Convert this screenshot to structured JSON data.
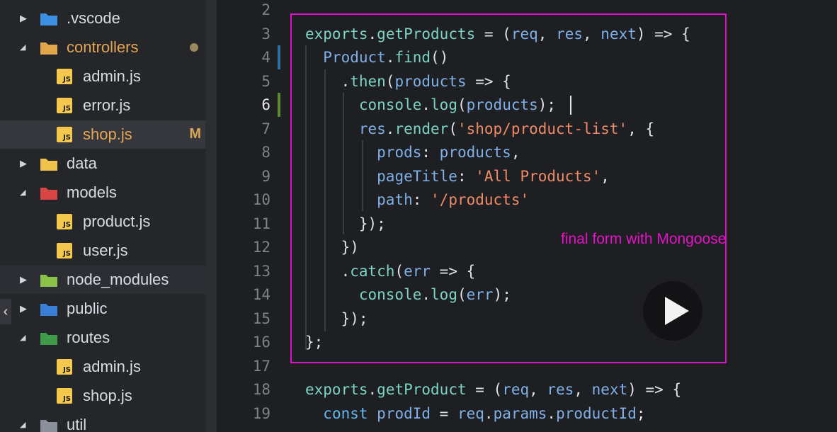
{
  "explorer": {
    "items": [
      {
        "name": ".vscode",
        "kind": "folder",
        "expanded": false,
        "icon": "vscode-folder-icon"
      },
      {
        "name": "controllers",
        "kind": "folder",
        "expanded": true,
        "modified_dot": true,
        "icon": "controllers-folder-icon"
      },
      {
        "name": "admin.js",
        "kind": "file",
        "icon": "js-file-icon"
      },
      {
        "name": "error.js",
        "kind": "file",
        "icon": "js-file-icon"
      },
      {
        "name": "shop.js",
        "kind": "file",
        "selected": true,
        "status": "M",
        "icon": "js-file-icon"
      },
      {
        "name": "data",
        "kind": "folder",
        "expanded": false,
        "icon": "data-folder-icon"
      },
      {
        "name": "models",
        "kind": "folder",
        "expanded": true,
        "icon": "models-folder-icon"
      },
      {
        "name": "product.js",
        "kind": "file",
        "icon": "js-file-icon"
      },
      {
        "name": "user.js",
        "kind": "file",
        "icon": "js-file-icon"
      },
      {
        "name": "node_modules",
        "kind": "folder",
        "expanded": false,
        "icon": "node-modules-folder-icon"
      },
      {
        "name": "public",
        "kind": "folder",
        "expanded": false,
        "icon": "public-folder-icon"
      },
      {
        "name": "routes",
        "kind": "folder",
        "expanded": true,
        "icon": "routes-folder-icon"
      },
      {
        "name": "admin.js",
        "kind": "file",
        "icon": "js-file-icon"
      },
      {
        "name": "shop.js",
        "kind": "file",
        "icon": "js-file-icon"
      },
      {
        "name": "util",
        "kind": "folder",
        "expanded": true,
        "icon": "util-folder-icon"
      }
    ],
    "js_badge": "JS",
    "collapse_glyph": "‹"
  },
  "editor": {
    "line_numbers": [
      "2",
      "3",
      "4",
      "5",
      "6",
      "7",
      "8",
      "9",
      "10",
      "11",
      "12",
      "13",
      "14",
      "15",
      "16",
      "17",
      "18",
      "19"
    ],
    "active_line": "6",
    "lines": [
      "",
      "exports.getProducts = (req, res, next) => {",
      "  Product.find()",
      "    .then(products => {",
      "      console.log(products);",
      "      res.render('shop/product-list', {",
      "        prods: products,",
      "        pageTitle: 'All Products',",
      "        path: '/products'",
      "      });",
      "    })",
      "    .catch(err => {",
      "      console.log(err);",
      "    });",
      "};",
      "",
      "exports.getProduct = (req, res, next) => {",
      "  const prodId = req.params.productId;"
    ]
  },
  "annotation": {
    "text": "final form with Mongoose",
    "color": "#e512c7"
  },
  "colors": {
    "keyword": "#63b7ef",
    "function": "#7bd4c4",
    "string": "#f08a66",
    "param": "#7fb0e8",
    "box": "#e012c9"
  },
  "video": {
    "play_icon": "play-icon"
  }
}
